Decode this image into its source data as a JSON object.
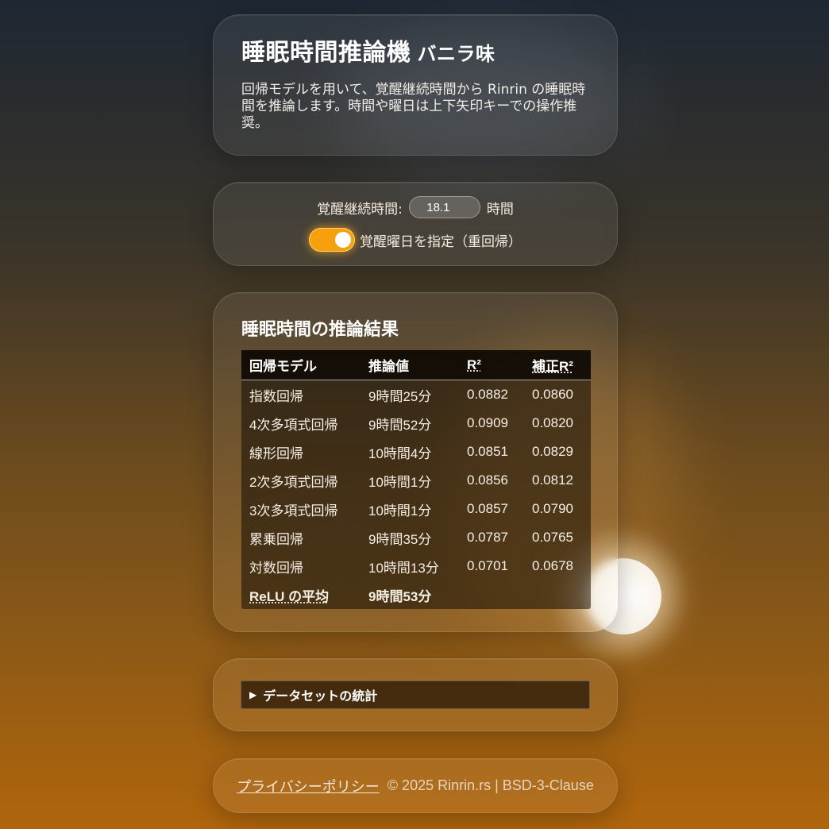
{
  "header": {
    "title": "睡眠時間推論機",
    "subtitle": "バニラ味",
    "description": "回帰モデルを用いて、覚醒継続時間から Rinrin の睡眠時間を推論します。時間や曜日は上下矢印キーでの操作推奨。"
  },
  "input": {
    "awake_label": "覚醒継続時間:",
    "awake_value": "18.1",
    "unit": "時間",
    "toggle_label": "覚醒曜日を指定（重回帰）",
    "toggle_on": true
  },
  "results": {
    "title": "睡眠時間の推論結果",
    "columns": [
      "回帰モデル",
      "推論値",
      "R²",
      "補正R²"
    ],
    "rows": [
      [
        "指数回帰",
        "9時間25分",
        "0.0882",
        "0.0860"
      ],
      [
        "4次多項式回帰",
        "9時間52分",
        "0.0909",
        "0.0820"
      ],
      [
        "線形回帰",
        "10時間4分",
        "0.0851",
        "0.0829"
      ],
      [
        "2次多項式回帰",
        "10時間1分",
        "0.0856",
        "0.0812"
      ],
      [
        "3次多項式回帰",
        "10時間1分",
        "0.0857",
        "0.0790"
      ],
      [
        "累乗回帰",
        "9時間35分",
        "0.0787",
        "0.0765"
      ],
      [
        "対数回帰",
        "10時間13分",
        "0.0701",
        "0.0678"
      ]
    ],
    "average_label": "ReLU の平均",
    "average_value": "9時間53分"
  },
  "stats": {
    "summary": "データセットの統計"
  },
  "footer": {
    "privacy": "プライバシーポリシー",
    "copyright": "© 2025 Rinrin.rs | BSD-3-Clause"
  },
  "colors": {
    "accent": "#f5a00c",
    "background_top": "#1e2733",
    "background_bottom": "#b0650c"
  }
}
